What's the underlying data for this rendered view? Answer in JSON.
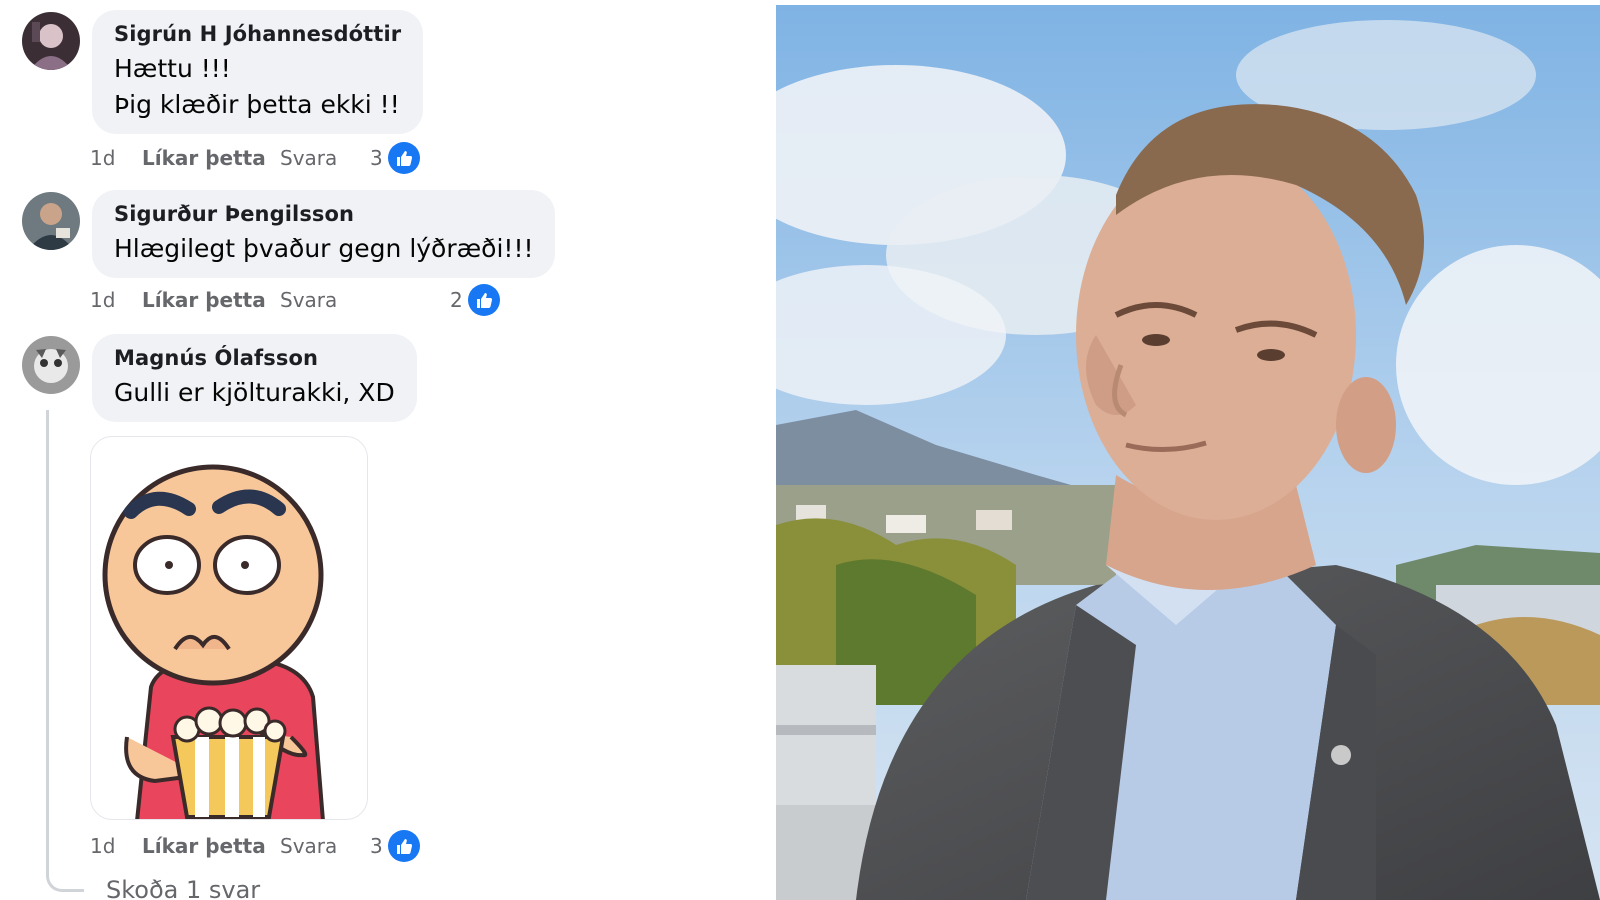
{
  "comments": [
    {
      "author": "Sigrún H Jóhannesdóttir",
      "text_lines": [
        "Hættu !!!",
        "Þig klæðir þetta ekki !!"
      ],
      "time": "1d",
      "like_label": "Líkar þetta",
      "reply_label": "Svara",
      "like_count": "3"
    },
    {
      "author": "Sigurður Þengilsson",
      "text_lines": [
        "Hlægilegt þvaður gegn lýðræði!!!"
      ],
      "time": "1d",
      "like_label": "Líkar þetta",
      "reply_label": "Svara",
      "like_count": "2"
    },
    {
      "author": "Magnús Ólafsson",
      "text_lines": [
        "Gulli er kjölturakki, XD"
      ],
      "time": "1d",
      "like_label": "Líkar þetta",
      "reply_label": "Svara",
      "like_count": "3",
      "sticker": "popcorn-eating-cartoon-sticker"
    }
  ],
  "view_replies_label": "Skoða 1 svar",
  "icons": {
    "reaction": "thumbs-up-icon"
  },
  "colors": {
    "like_blue": "#1877f2",
    "bubble_gray": "#f0f2f5",
    "meta_gray": "#65676b"
  }
}
